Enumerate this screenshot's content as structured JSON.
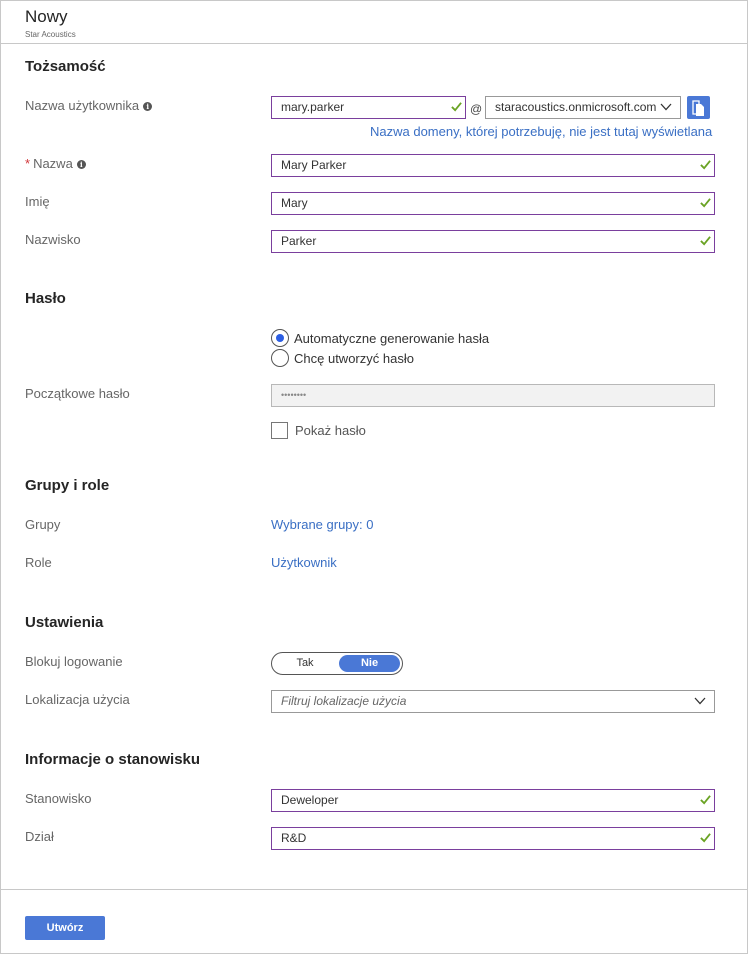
{
  "header": {
    "title": "Nowy",
    "subtitle": "Star Acoustics"
  },
  "identity": {
    "section_title": "Tożsamość",
    "username": {
      "label": "Nazwa użytkownika",
      "value": "mary.parker",
      "at": "@",
      "domain": "staracoustics.onmicrosoft.com",
      "domain_link": "Nazwa domeny, której potrzebuję, nie jest tutaj wyświetlana"
    },
    "name": {
      "label": "Nazwa",
      "required_mark": "*",
      "value": "Mary Parker"
    },
    "first_name": {
      "label": "Imię",
      "value": "Mary"
    },
    "last_name": {
      "label": "Nazwisko",
      "value": "Parker"
    }
  },
  "password": {
    "section_title": "Hasło",
    "options": [
      {
        "label": "Automatyczne generowanie hasła",
        "selected": true
      },
      {
        "label": "Chcę utworzyć hasło",
        "selected": false
      }
    ],
    "initial_label": "Początkowe hasło",
    "initial_value": "••••••••",
    "show_label": "Pokaż hasło",
    "show_checked": false
  },
  "groups_roles": {
    "section_title": "Grupy i role",
    "groups_label": "Grupy",
    "groups_value": "Wybrane grupy: 0",
    "roles_label": "Role",
    "roles_value": "Użytkownik"
  },
  "settings": {
    "section_title": "Ustawienia",
    "block_label": "Blokuj logowanie",
    "toggle_yes": "Tak",
    "toggle_no": "Nie",
    "toggle_selected": "Nie",
    "location_label": "Lokalizacja użycia",
    "location_placeholder": "Filtruj lokalizacje użycia"
  },
  "job": {
    "section_title": "Informacje o stanowisku",
    "title_label": "Stanowisko",
    "title_value": "Deweloper",
    "dept_label": "Dział",
    "dept_value": "R&D"
  },
  "footer": {
    "create_label": "Utwórz"
  },
  "colors": {
    "accent": "#4a78d6",
    "input_border": "#7a3f9d",
    "valid_check": "#6aa324",
    "link": "#3a6fc4",
    "required": "#d13438"
  }
}
